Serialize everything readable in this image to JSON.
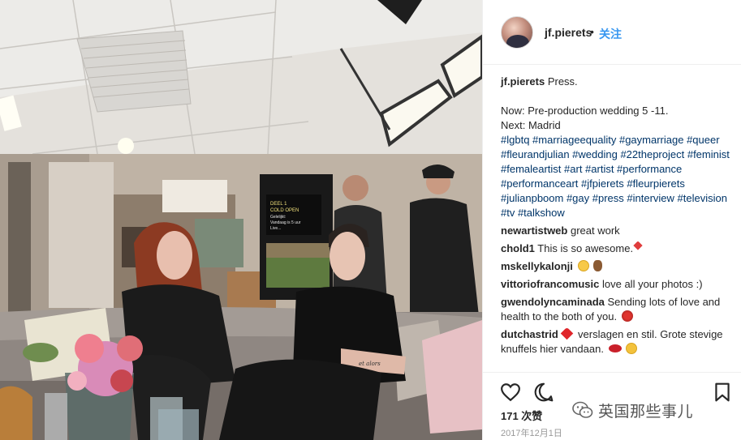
{
  "post": {
    "username": "jf.pierets",
    "separator": "•",
    "follow_label": "关注"
  },
  "caption": {
    "username": "jf.pierets",
    "text": "Press.",
    "line2": "Now: Pre-production wedding 5 -11.",
    "line3": "Next: Madrid",
    "hashtags": "#lgbtq #marriageequality #gaymarriage #queer #fleurandjulian #wedding #22theproject #feminist #femaleartist #art #artist #performance #performanceart #jfpierets #fleurpierets #julianpboom #gay #press #interview #television #tv #talkshow"
  },
  "comments": [
    {
      "user": "newartistweb",
      "text": "great work",
      "emoji": ""
    },
    {
      "user": "chold1",
      "text": "This is so awesome.",
      "emoji": "heart-sm"
    },
    {
      "user": "mskellykalonji",
      "text": "",
      "emoji": "smile-hand"
    },
    {
      "user": "vittoriofrancomusic",
      "text": "love all your photos :)",
      "emoji": ""
    },
    {
      "user": "gwendolyncaminada",
      "text": "Sending lots of love and health to the both of you.",
      "emoji": "rose"
    },
    {
      "user": "dutchastrid",
      "text": "verslagen en stil. Grote stevige knuffels hier vandaan.",
      "emoji": "heart-lips-smile"
    }
  ],
  "actions": {
    "like_icon": "heart-outline-icon",
    "comment_icon": "speech-bubble-icon",
    "save_icon": "bookmark-icon",
    "likes": "171 次赞",
    "date": "2017年12月1日"
  },
  "watermark": {
    "icon": "wechat-icon",
    "text": "英国那些事儿"
  },
  "photo_overlay": {
    "monitor_line1": "DEEL 1",
    "monitor_line2": "COLD OPEN",
    "monitor_line3": "Gelelijkt:",
    "monitor_line4": "Vandaag is 5 uur",
    "monitor_line5": "Live...",
    "tattoo": "et alors"
  },
  "colors": {
    "link": "#003569",
    "follow": "#3897f0",
    "text": "#262626",
    "muted": "#999999"
  }
}
